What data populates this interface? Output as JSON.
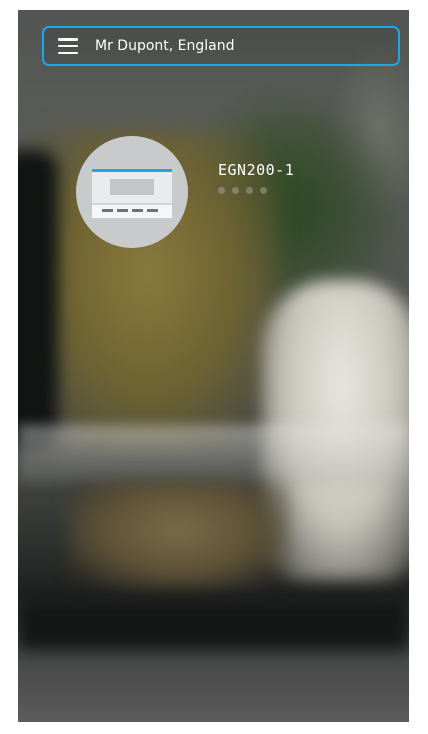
{
  "header": {
    "location": "Mr Dupont, England",
    "menu_icon": "hamburger-menu-icon"
  },
  "device": {
    "name": "EGN200-1",
    "icon": "thermostat-icon",
    "status_dots": 4
  },
  "colors": {
    "accent": "#1aa8e6",
    "avatar_bg": "#c9cacb"
  }
}
